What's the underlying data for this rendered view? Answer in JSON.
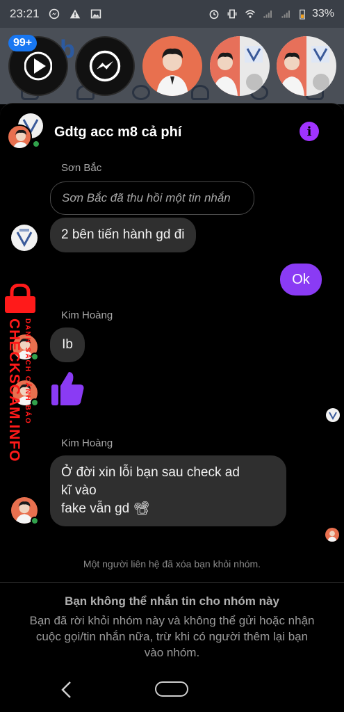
{
  "status_bar": {
    "time": "23:21",
    "battery": "33%"
  },
  "background_app": {
    "logo": "b",
    "badge_count": "99+"
  },
  "chat": {
    "title": "Gdtg acc m8 cả phí",
    "info_label": "i",
    "messages": [
      {
        "sender": "Sơn Bắc",
        "recalled_text": "Sơn Bắc đã thu hồi một tin nhắn",
        "text": "2 bên tiến hành gd đi"
      },
      {
        "sender": "me",
        "text": "Ok"
      },
      {
        "sender": "Kim Hoàng",
        "text": "Ib",
        "reaction": "👍"
      },
      {
        "sender": "Kim Hoàng",
        "text_lines": [
          "Ở đời xin lỗi bạn sau check ad",
          "kĩ vào",
          "fake vẫn gd 📽"
        ]
      }
    ],
    "system_note": "Một người liên hệ đã xóa bạn khỏi nhóm.",
    "blocked_title": "Bạn không thể nhắn tin cho nhóm này",
    "blocked_text": "Bạn đã rời khỏi nhóm này và không thể gửi hoặc nhận cuộc gọi/tin nhắn nữa, trừ khi có người thêm lại bạn vào nhóm."
  },
  "watermark": {
    "text": "CHECKSCAM.INFO",
    "small_text": "DANH SÁCH CẢNH BÁO"
  },
  "colors": {
    "accent": "#8a3bf4",
    "bubble": "#2f2f2f",
    "online": "#31a24c",
    "watermark": "#ff1a1a",
    "badge": "#1877f2"
  },
  "icons": [
    "messenger-icon",
    "warning-icon",
    "gallery-icon",
    "alarm-icon",
    "vibrate-icon",
    "wifi-icon",
    "signal-icon",
    "battery-icon",
    "play-icon",
    "info-icon",
    "thumbs-up-icon",
    "lock-icon",
    "back-icon",
    "home-icon"
  ]
}
